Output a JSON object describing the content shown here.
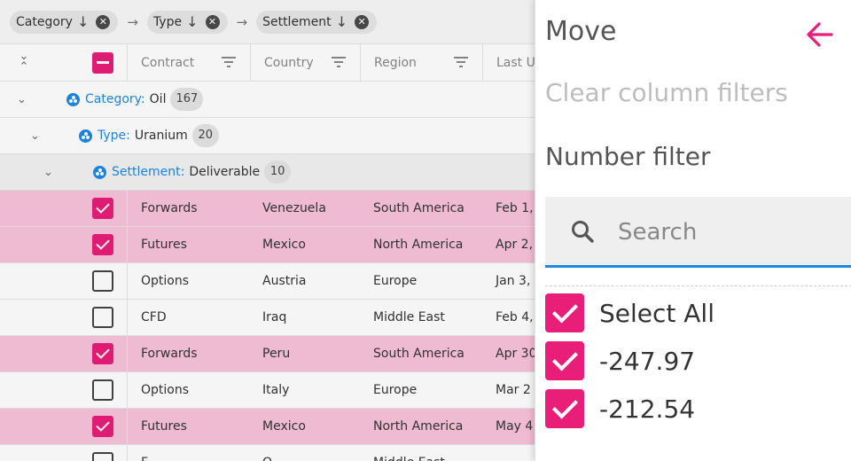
{
  "group_bar": {
    "chips": [
      {
        "label": "Category"
      },
      {
        "label": "Type"
      },
      {
        "label": "Settlement"
      }
    ]
  },
  "columns": [
    "Contract",
    "Country",
    "Region",
    "Last Up"
  ],
  "groups": [
    {
      "key": "Category:",
      "value": "Oil",
      "count": "167"
    },
    {
      "key": "Type:",
      "value": "Uranium",
      "count": "20"
    },
    {
      "key": "Settlement:",
      "value": "Deliverable",
      "count": "10"
    }
  ],
  "rows": [
    {
      "selected": true,
      "contract": "Forwards",
      "country": "Venezuela",
      "region": "South America",
      "date": "Feb 1,"
    },
    {
      "selected": true,
      "contract": "Futures",
      "country": "Mexico",
      "region": "North America",
      "date": "Apr 2,"
    },
    {
      "selected": false,
      "contract": "Options",
      "country": "Austria",
      "region": "Europe",
      "date": "Jan 3,"
    },
    {
      "selected": false,
      "contract": "CFD",
      "country": "Iraq",
      "region": "Middle East",
      "date": "Feb 4,"
    },
    {
      "selected": true,
      "contract": "Forwards",
      "country": "Peru",
      "region": "South America",
      "date": "Apr 30"
    },
    {
      "selected": false,
      "contract": "Options",
      "country": "Italy",
      "region": "Europe",
      "date": "Mar 2"
    },
    {
      "selected": true,
      "contract": "Futures",
      "country": "Mexico",
      "region": "North America",
      "date": "May 4"
    },
    {
      "selected": false,
      "contract": "F",
      "country": "O",
      "region": "Middle East",
      "date": ""
    }
  ],
  "menu": {
    "move": "Move",
    "clear_filters": "Clear column filters",
    "number_filter": "Number filter",
    "search_placeholder": "Search",
    "options": [
      {
        "label": "Select All",
        "checked": true
      },
      {
        "label": "-247.97",
        "checked": true
      },
      {
        "label": "-212.54",
        "checked": true
      }
    ]
  },
  "colors": {
    "accent": "#e91e78",
    "selected_row": "#f9c3dc",
    "group_key": "#1e88e5",
    "focus_line": "#1e88e5"
  }
}
